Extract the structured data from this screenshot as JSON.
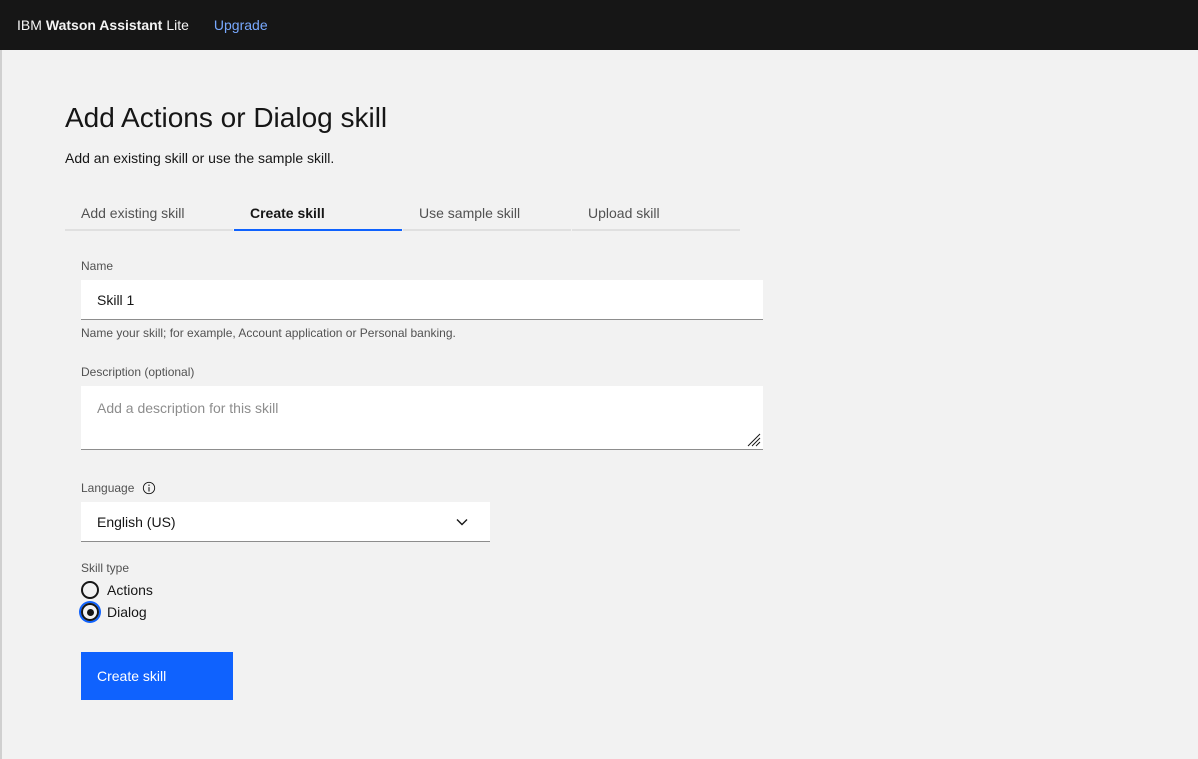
{
  "topbar": {
    "brand_prefix": "IBM",
    "brand_bold": "Watson Assistant",
    "brand_suffix": "Lite",
    "upgrade_label": "Upgrade"
  },
  "page": {
    "title": "Add Actions or Dialog skill",
    "subtitle": "Add an existing skill or use the sample skill."
  },
  "tabs": [
    {
      "label": "Add existing skill",
      "active": false
    },
    {
      "label": "Create skill",
      "active": true
    },
    {
      "label": "Use sample skill",
      "active": false
    },
    {
      "label": "Upload skill",
      "active": false
    }
  ],
  "form": {
    "name_label": "Name",
    "name_value": "Skill 1",
    "name_helper": "Name your skill; for example, Account application or Personal banking.",
    "description_label": "Description (optional)",
    "description_placeholder": "Add a description for this skill",
    "language_label": "Language",
    "language_value": "English (US)",
    "skill_type_label": "Skill type",
    "skill_types": [
      {
        "label": "Actions",
        "checked": false
      },
      {
        "label": "Dialog",
        "checked": true
      }
    ],
    "submit_label": "Create skill"
  },
  "colors": {
    "topbar_bg": "#161616",
    "link": "#78a9ff",
    "primary": "#0f62fe",
    "page_bg": "#f2f2f2"
  }
}
